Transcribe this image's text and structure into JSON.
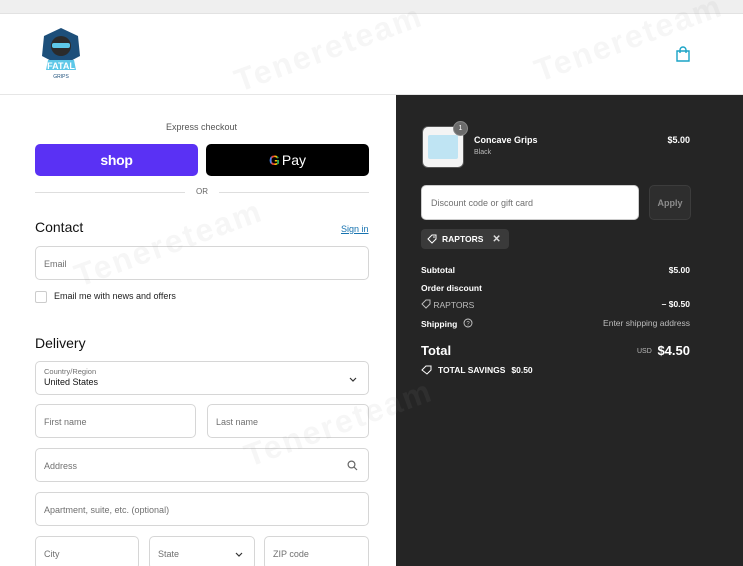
{
  "store": {
    "logo_text": "FATAL",
    "logo_subtext": "GRIPS"
  },
  "express": {
    "title": "Express checkout",
    "shop_label": "shop",
    "gpay_g": "G",
    "gpay_label": "Pay",
    "or": "OR"
  },
  "contact": {
    "title": "Contact",
    "sign_in": "Sign in",
    "email_placeholder": "Email",
    "newsletter_label": "Email me with news and offers"
  },
  "delivery": {
    "title": "Delivery",
    "country_label": "Country/Region",
    "country_value": "United States",
    "first_name": "First name",
    "last_name": "Last name",
    "address": "Address",
    "apartment": "Apartment, suite, etc. (optional)",
    "city": "City",
    "state": "State",
    "zip": "ZIP code"
  },
  "order": {
    "item": {
      "name": "Concave Grips",
      "variant": "Black",
      "price": "$5.00",
      "quantity": "1"
    },
    "discount_placeholder": "Discount code or gift card",
    "apply_label": "Apply",
    "code": "RAPTORS",
    "subtotal_label": "Subtotal",
    "subtotal_value": "$5.00",
    "order_discount_label": "Order discount",
    "discount_code": "RAPTORS",
    "discount_value": "– $0.50",
    "shipping_label": "Shipping",
    "shipping_value": "Enter shipping address",
    "total_label": "Total",
    "currency": "USD",
    "total_value": "$4.50",
    "savings_label": "TOTAL SAVINGS",
    "savings_value": "$0.50"
  },
  "watermark": "Tenereteam",
  "colors": {
    "shop": "#5a31f4",
    "summary_bg": "#252525",
    "link": "#1773b0"
  }
}
